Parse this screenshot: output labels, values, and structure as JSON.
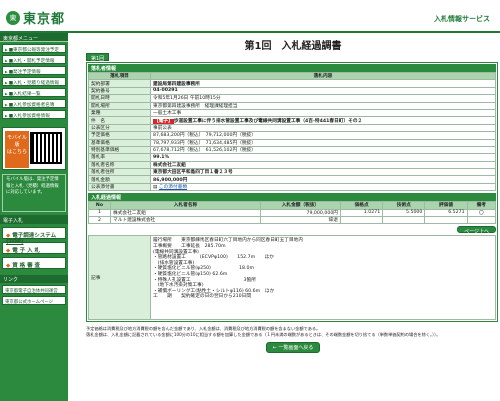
{
  "header": {
    "logo_mark": "東",
    "logo_text": "東京都",
    "site_title": "入札情報サービス"
  },
  "sidebar": {
    "menu_title": "東京都メニュー",
    "items": [
      "■東京都公報等発注予定",
      "■入札・開札予定情報",
      "■発注予定情報",
      "■入札・見積り経過情報",
      "■入札結果一覧",
      "■入札参加資格者名簿",
      "■入札参加資格情報"
    ],
    "mobile_label": "モバイル版",
    "mobile_sub": "はこちら",
    "note": "モバイル版は、発注予定情報と入札（見積）経過情報に対応しています。",
    "section2_title": "電子入札",
    "big_links": [
      {
        "sym": "◆",
        "label": "電子調達システム(TOP)"
      },
      {
        "sym": "◆",
        "label": "電 子 入 札"
      },
      {
        "sym": "◆",
        "label": "資 格 審 査"
      }
    ],
    "links_title": "リンク",
    "ext_links": [
      "東京都電子自治体共同運営",
      "東京都公式ホームページ"
    ]
  },
  "main": {
    "title": "第1回　入札経過調書",
    "round_tab": "第1回",
    "info_section": "落札者情報",
    "info_headers": [
      "落札項目",
      "落札内容"
    ],
    "info_rows": [
      {
        "k": "契約部署",
        "v": "建設局第四建設事務所",
        "bold": true
      },
      {
        "k": "契約番号",
        "v": "04-00291",
        "bold": true
      },
      {
        "k": "開札日時",
        "v": "令和5年1月26日 午前10時15分",
        "bold": false
      },
      {
        "k": "開札場所",
        "v": "東京都第四建設事務所　経理課経理担当",
        "bold": false
      },
      {
        "k": "業種",
        "v": "一般土木工事",
        "bold": false
      },
      {
        "k": "件　名",
        "tag": "【電子】",
        "v": "歩道設置工事に伴う排水管設置工事及び電線共同溝設置工事（4百-特441春日町）その２",
        "bold": true
      },
      {
        "k": "公表区分",
        "v": "事前公表",
        "bold": false
      },
      {
        "k": "予定価格",
        "v": "87,683,200円（税込）　79,712,000円（税抜）",
        "bold": false
      },
      {
        "k": "基準価格",
        "v": "78,797,933円（税込）　71,634,485円（税抜）",
        "bold": false
      },
      {
        "k": "特別基準価格",
        "v": "67,678,712円（税込）　61,526,102円（税抜）",
        "bold": false
      },
      {
        "k": "落札率",
        "v": "99.1%",
        "bold": true
      },
      {
        "k": "落札者名称",
        "v": "株式会社二友組",
        "bold": true
      },
      {
        "k": "落札者住所",
        "v": "東京都大田区平和島四丁目１番２３号",
        "bold": true
      },
      {
        "k": "落札金額",
        "v": "86,900,000円",
        "bold": true
      }
    ],
    "public_docs_label": "公表添付書",
    "public_docs_link": "この添付書類",
    "bid_section": "入札経過情報",
    "bid_headers": [
      "No",
      "入札者名称",
      "入札金額（税抜）",
      "価格点",
      "技術点",
      "評価値",
      "備考"
    ],
    "bid_rows": [
      {
        "no": "1",
        "name": "株式会社二友組",
        "amount": "79,000,000円",
        "price": "1.0271",
        "tech": "5.5000",
        "eval": "6.5271",
        "note": "〇"
      },
      {
        "no": "2",
        "name": "マルト建設株式会社",
        "amount": "辞退",
        "price": "",
        "tech": "",
        "eval": "",
        "note": ""
      }
    ],
    "page_top": "ページ上へ",
    "remarks_label": "記事",
    "remarks": "履行場所　　東京都練馬区春日町六丁目地内から同区春日町五丁目地内\n工事概要　　工事延長　285.70m\n(電線共同溝設置工事)\n・管路材設置工　　　(ECVPφ100)　　152.7m　　ほか\n　(排水管設置工事)\n・硬質塩化ビニル管(φ250)　　　　　　18.0m\n・硬質塩化ビニル管(φ150) 62.6m\n・特殊人孔設置工　　　　　　　　　　　 3箇所\n　(地下水汚染対策工事)\n・補償ボーリング工(粘性土・シルトφ116) 60.6m　ほか\n工　　期　　契約確定の日の翌日から210日間",
    "footnote": "予定価格は消費税及び地方消費税の額を含んだ金額であり、入札金額は、消費税及び地方消費税の額を含まない金額である。\n落札金額は、入札金額に記載されている金額に100分の10に相当する額を加算した金額である（１円未満の端数があるときは、その端数金額を切り捨てる（単数単価契約の場合を除く。））。",
    "back_button": "← 一覧画面へ戻る"
  }
}
